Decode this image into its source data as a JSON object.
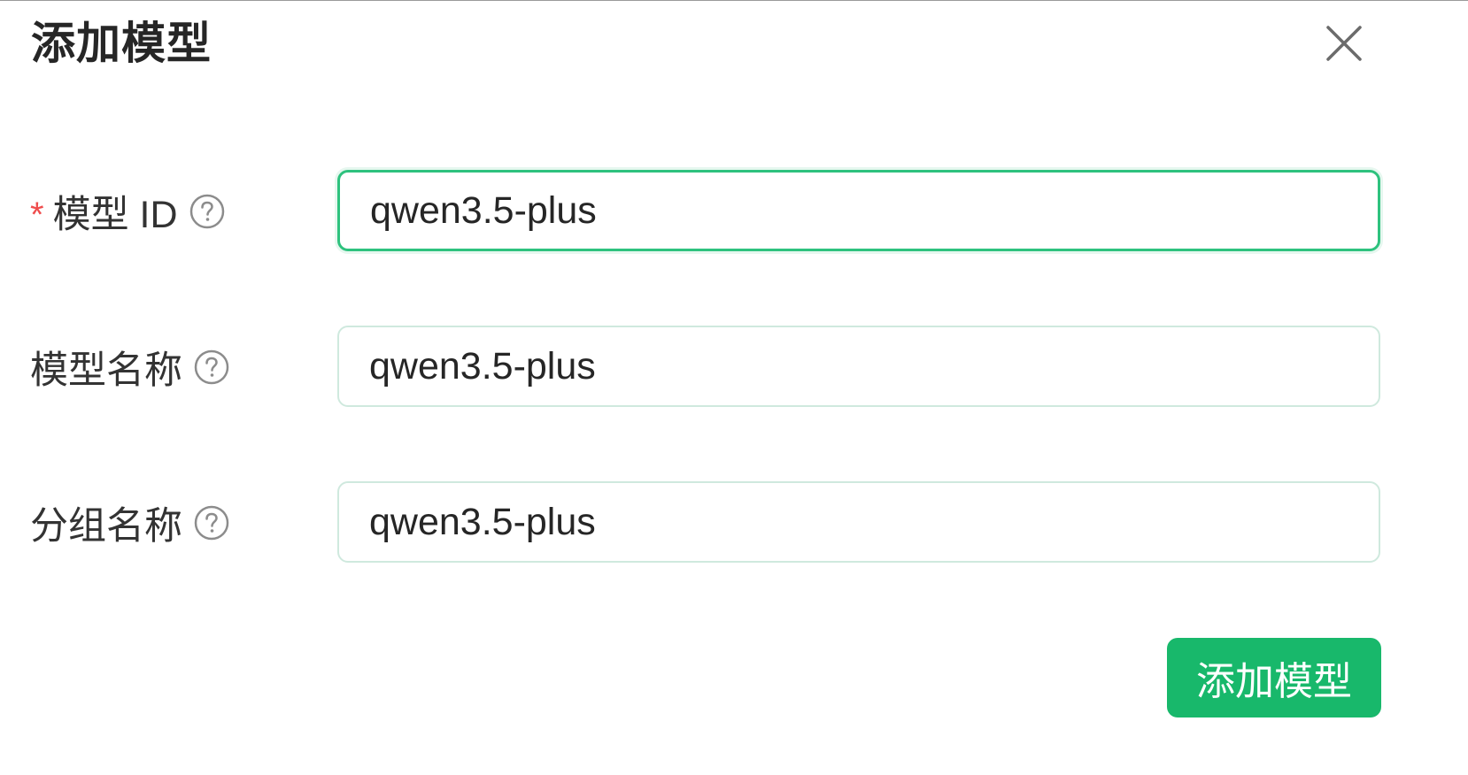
{
  "dialog": {
    "title": "添加模型",
    "close_icon": "close-icon"
  },
  "form": {
    "fields": [
      {
        "label": "模型 ID",
        "required": true,
        "required_mark": "*",
        "value": "qwen3.5-plus",
        "help_icon": "question-circle-icon",
        "focused": true
      },
      {
        "label": "模型名称",
        "required": false,
        "value": "qwen3.5-plus",
        "help_icon": "question-circle-icon",
        "focused": false
      },
      {
        "label": "分组名称",
        "required": false,
        "value": "qwen3.5-plus",
        "help_icon": "question-circle-icon",
        "focused": false
      }
    ],
    "submit_label": "添加模型"
  },
  "colors": {
    "primary": "#18b86b",
    "focus_border": "#2ec27e",
    "input_border": "#cfe9de",
    "required_mark": "#ef4d4d",
    "text": "#333333"
  }
}
